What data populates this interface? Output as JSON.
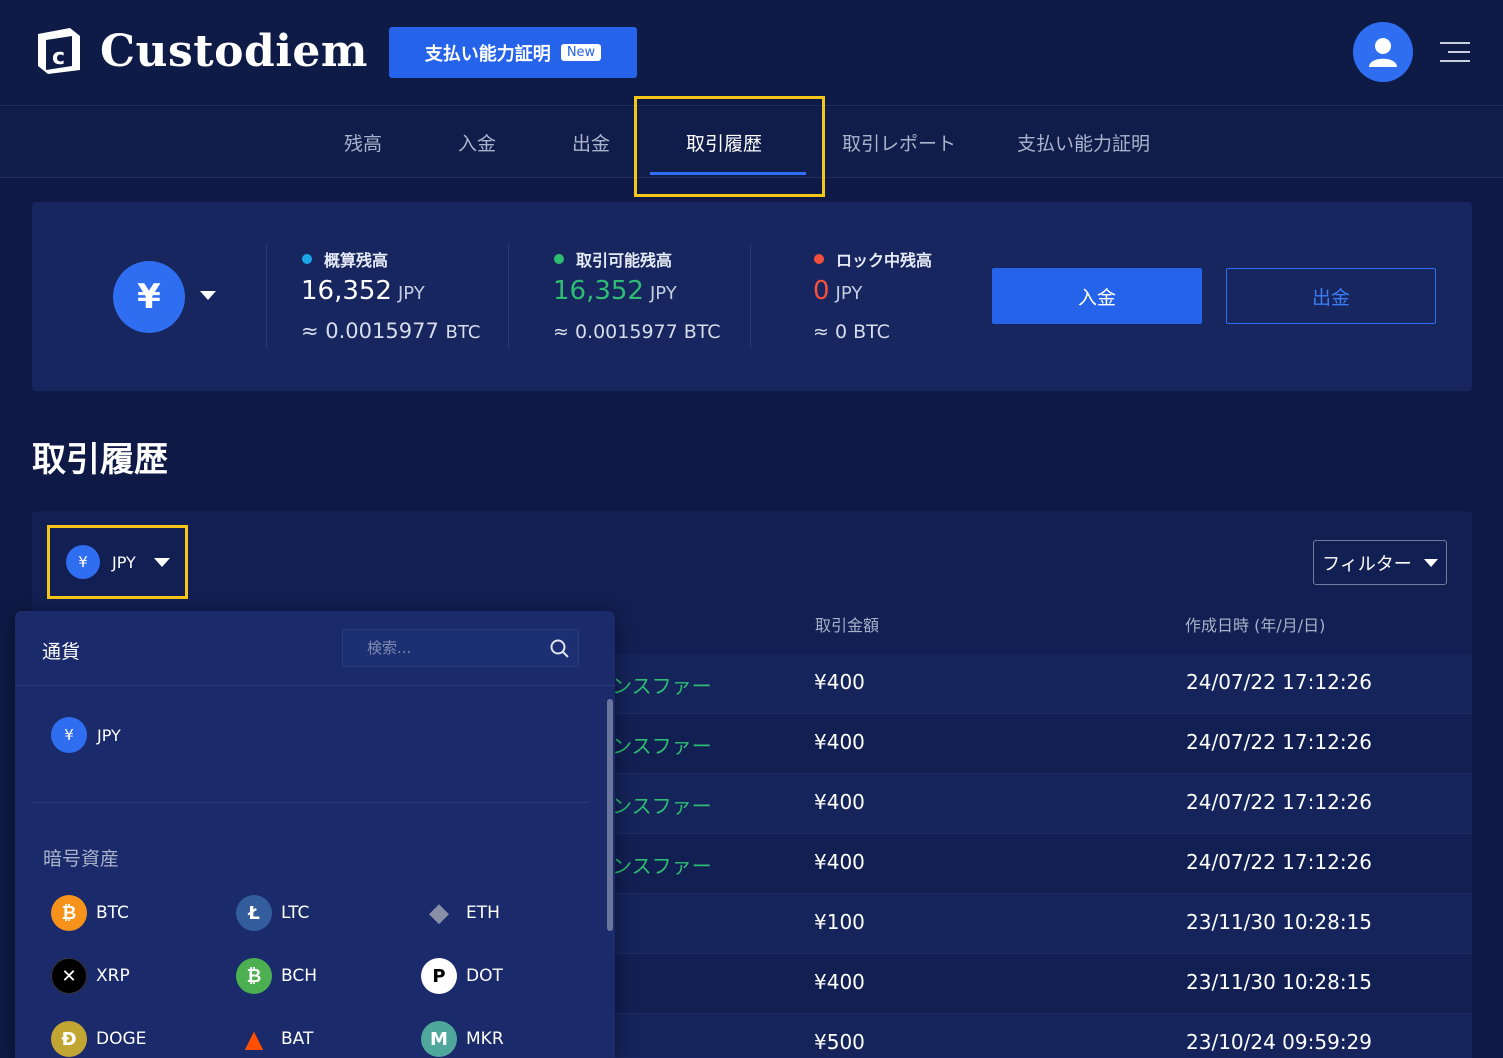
{
  "header": {
    "brand": "Custodiem",
    "proof_button": "支払い能力証明",
    "new_badge": "New"
  },
  "tabs": [
    {
      "label": "残高"
    },
    {
      "label": "入金"
    },
    {
      "label": "出金"
    },
    {
      "label": "取引履歴"
    },
    {
      "label": "取引レポート"
    },
    {
      "label": "支払い能力証明"
    }
  ],
  "balance": {
    "currency_symbol": "¥",
    "estimated": {
      "label": "概算残高",
      "amount": "16,352",
      "unit": "JPY",
      "btc": "≈ 0.0015977",
      "btc_unit": "BTC"
    },
    "available": {
      "label": "取引可能残高",
      "amount": "16,352",
      "unit": "JPY",
      "btc": "≈ 0.0015977 BTC"
    },
    "locked": {
      "label": "ロック中残高",
      "amount": "0",
      "unit": "JPY",
      "btc": "≈ 0 BTC"
    },
    "deposit_button": "入金",
    "withdraw_button": "出金"
  },
  "history": {
    "title": "取引履歴",
    "currency_select": {
      "symbol": "¥",
      "label": "JPY"
    },
    "filter_button": "フィルター",
    "columns": {
      "amount": "取引金額",
      "created": "作成日時 (年/月/日)"
    },
    "rows": [
      {
        "type": "ンスファー",
        "amount": "¥400",
        "created": "24/07/22 17:12:26"
      },
      {
        "type": "ンスファー",
        "amount": "¥400",
        "created": "24/07/22 17:12:26"
      },
      {
        "type": "ンスファー",
        "amount": "¥400",
        "created": "24/07/22 17:12:26"
      },
      {
        "type": "ンスファー",
        "amount": "¥400",
        "created": "24/07/22 17:12:26"
      },
      {
        "type": "",
        "amount": "¥100",
        "created": "23/11/30 10:28:15"
      },
      {
        "type": "",
        "amount": "¥400",
        "created": "23/11/30 10:28:15"
      },
      {
        "type": "",
        "amount": "¥500",
        "created": "23/10/24 09:59:29"
      }
    ]
  },
  "dropdown": {
    "title": "通貨",
    "search_placeholder": "検索...",
    "fiat": {
      "symbol": "¥",
      "label": "JPY"
    },
    "crypto_label": "暗号資産",
    "coins": [
      {
        "label": "BTC",
        "glyph": "₿",
        "color": "#f7931a"
      },
      {
        "label": "LTC",
        "glyph": "Ł",
        "color": "#345d9d"
      },
      {
        "label": "ETH",
        "glyph": "◆",
        "color": "#3c3c5d"
      },
      {
        "label": "XRP",
        "glyph": "✕",
        "color": "#111111"
      },
      {
        "label": "BCH",
        "glyph": "₿",
        "color": "#4caf50"
      },
      {
        "label": "DOT",
        "glyph": "P",
        "color": "#ffffff"
      },
      {
        "label": "DOGE",
        "glyph": "Ð",
        "color": "#c2a633"
      },
      {
        "label": "BAT",
        "glyph": "▲",
        "color": "#ff5000"
      },
      {
        "label": "MKR",
        "glyph": "M",
        "color": "#4fa89b"
      }
    ]
  }
}
